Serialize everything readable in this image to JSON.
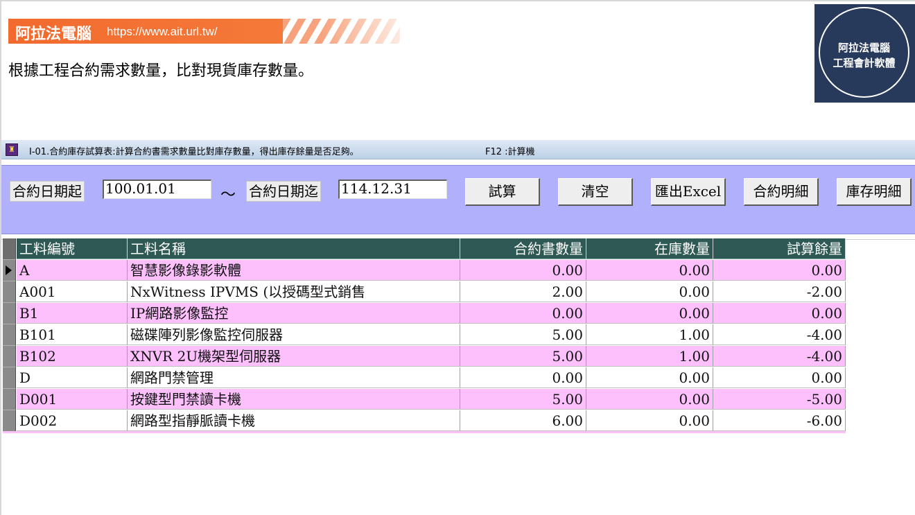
{
  "banner": {
    "title": "阿拉法電腦",
    "url": "https://www.ait.url.tw/"
  },
  "intro": "根據工程合約需求數量，比對現貨庫存數量。",
  "logo": {
    "line1": "阿拉法電腦",
    "line2": "工程會計軟體"
  },
  "window": {
    "title": "I-01.合約庫存試算表:計算合約書需求數量比對庫存數量，得出庫存餘量是否足夠。",
    "hint": "F12 :計算機"
  },
  "filters": {
    "start_label": "合約日期起",
    "start_value": "100.01.01",
    "range_sep": "～",
    "end_label": "合約日期迄",
    "end_value": "114.12.31"
  },
  "buttons": {
    "calculate": "試算",
    "clear": "清空",
    "export": "匯出Excel",
    "contract_detail": "合約明細",
    "stock_detail": "庫存明細"
  },
  "table": {
    "columns": [
      "工料編號",
      "工料名稱",
      "合約書數量",
      "在庫數量",
      "試算餘量"
    ],
    "rows": [
      [
        "A",
        "智慧影像錄影軟體",
        "0.00",
        "0.00",
        "0.00"
      ],
      [
        "A001",
        "NxWitness IPVMS (以授碼型式銷售",
        "2.00",
        "0.00",
        "-2.00"
      ],
      [
        "B1",
        "IP網路影像監控",
        "0.00",
        "0.00",
        "0.00"
      ],
      [
        "B101",
        "磁碟陣列影像監控伺服器",
        "5.00",
        "1.00",
        "-4.00"
      ],
      [
        "B102",
        "XNVR 2U機架型伺服器",
        "5.00",
        "1.00",
        "-4.00"
      ],
      [
        "D",
        "網路門禁管理",
        "0.00",
        "0.00",
        "0.00"
      ],
      [
        "D001",
        "按鍵型門禁讀卡機",
        "5.00",
        "0.00",
        "-5.00"
      ],
      [
        "D002",
        "網路型指靜脈讀卡機",
        "6.00",
        "0.00",
        "-6.00"
      ]
    ]
  },
  "colors": {
    "banner": "#f26a2e",
    "logo_bg": "#283a5b",
    "panel_bg": "#b0b0fc",
    "header_bg": "#2f5954",
    "row_alt": "#fdc0fd"
  }
}
